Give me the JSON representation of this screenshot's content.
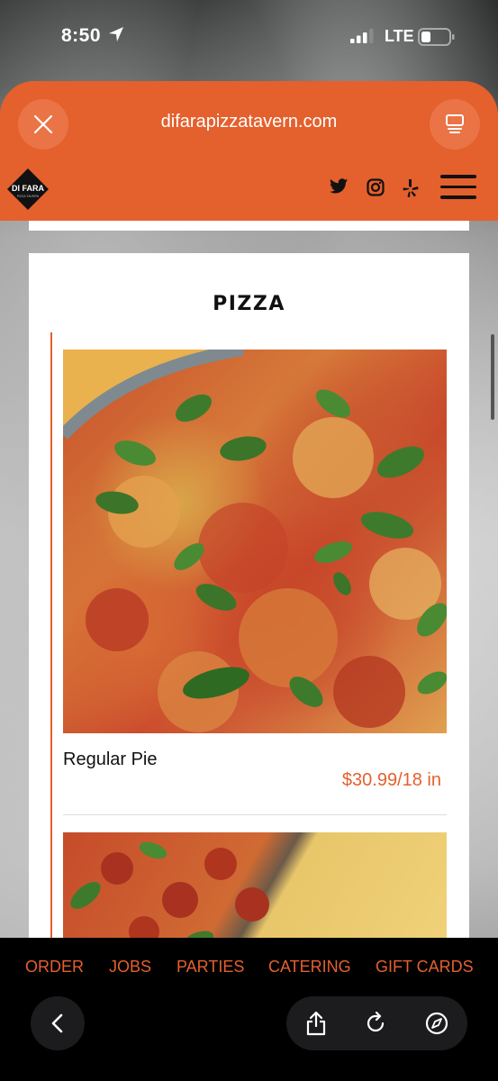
{
  "status_bar": {
    "time": "8:50",
    "network": "LTE"
  },
  "browser": {
    "url": "difarapizzatavern.com"
  },
  "site_header": {
    "logo_text": "DI FARA",
    "logo_subtext": "PIZZA TAVERN",
    "accent_color": "#e4602d"
  },
  "menu_section": {
    "title": "PIZZA",
    "items": [
      {
        "name": "Regular Pie",
        "price": "$30.99/18 in"
      }
    ]
  },
  "bottom_nav": {
    "items": [
      "ORDER",
      "JOBS",
      "PARTIES",
      "CATERING",
      "GIFT CARDS"
    ]
  }
}
